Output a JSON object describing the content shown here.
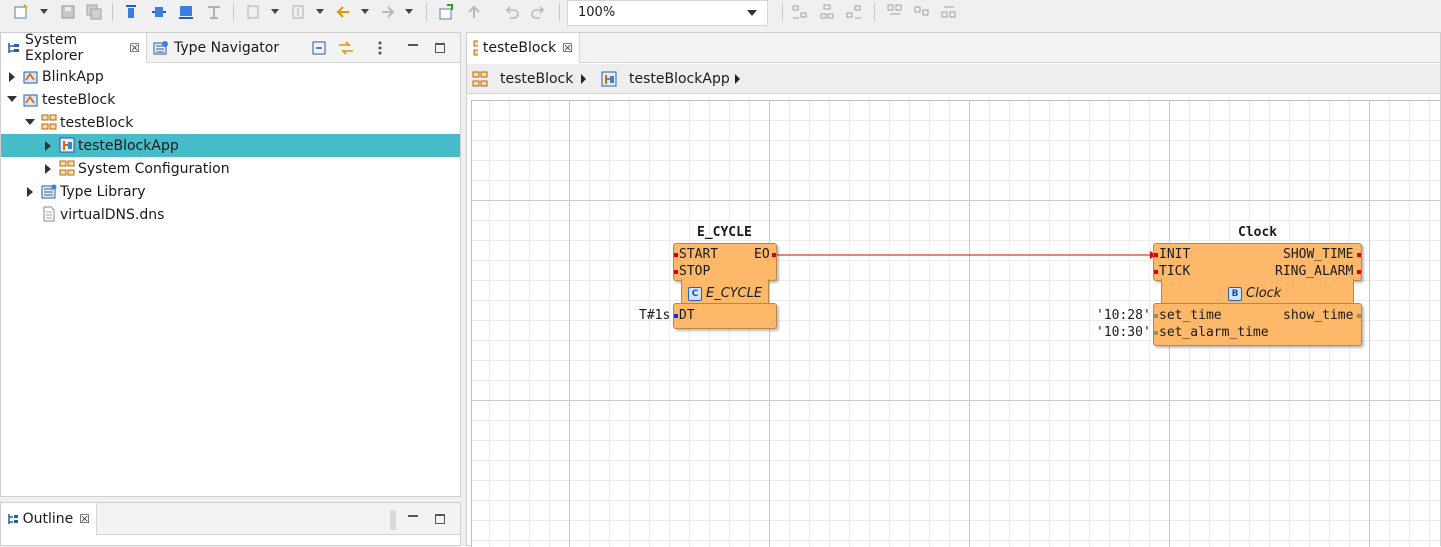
{
  "toolbar": {
    "zoom_value": "100%"
  },
  "left_panel": {
    "tabs": [
      {
        "label": "System Explorer",
        "active": true
      },
      {
        "label": "Type Navigator",
        "active": false
      }
    ],
    "tree": [
      {
        "label": "BlinkApp"
      },
      {
        "label": "testeBlock"
      },
      {
        "label": "testeBlock"
      },
      {
        "label": "testeBlockApp"
      },
      {
        "label": "System Configuration"
      },
      {
        "label": "Type Library"
      },
      {
        "label": "virtualDNS.dns"
      }
    ]
  },
  "outline": {
    "tab_label": "Outline"
  },
  "editor": {
    "tab_label": "testeBlock",
    "breadcrumb": [
      {
        "label": "testeBlock"
      },
      {
        "label": "testeBlockApp"
      }
    ],
    "blocks": {
      "e_cycle": {
        "instance_name": "E_CYCLE",
        "type_name": "E_CYCLE",
        "type_badge": "C",
        "event_inputs": [
          "START",
          "STOP"
        ],
        "event_outputs": [
          "EO"
        ],
        "data_inputs": [
          "DT"
        ],
        "dt_value": "T#1s"
      },
      "clock": {
        "instance_name": "Clock",
        "type_name": "Clock",
        "type_badge": "B",
        "event_inputs": [
          "INIT",
          "TICK"
        ],
        "event_outputs": [
          "SHOW_TIME",
          "RING_ALARM"
        ],
        "data_inputs": [
          "set_time",
          "set_alarm_time"
        ],
        "data_outputs": [
          "show_time"
        ],
        "set_time_value": "'10:28'",
        "set_alarm_time_value": "'10:30'"
      }
    }
  },
  "colors": {
    "selection": "#45bcc8",
    "block_fill": "#fdb969",
    "event_connection": "#e00000",
    "data_pin": "#1030e0"
  }
}
